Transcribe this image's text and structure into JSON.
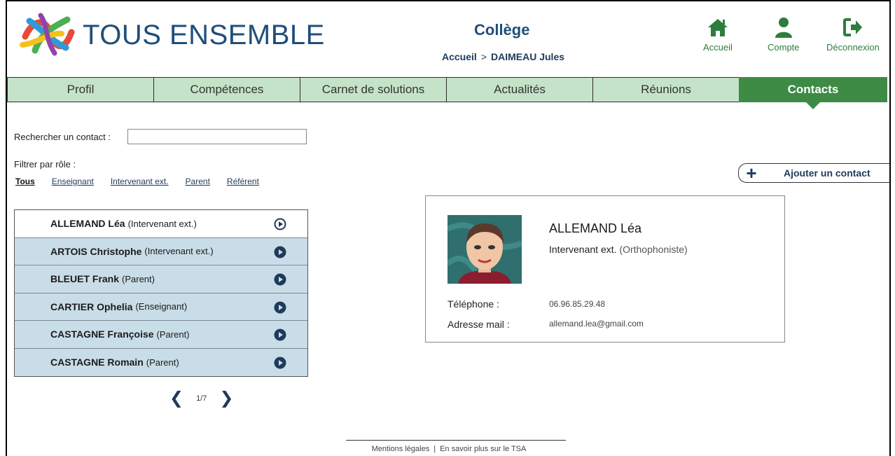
{
  "brand": "TOUS ENSEMBLE",
  "college": "Collège",
  "breadcrumb": {
    "home": "Accueil",
    "separator": ">",
    "current": "DAIMEAU Jules"
  },
  "top_nav": {
    "home": "Accueil",
    "account": "Compte",
    "logout": "Déconnexion"
  },
  "tabs": [
    "Profil",
    "Compétences",
    "Carnet de solutions",
    "Actualités",
    "Réunions",
    "Contacts"
  ],
  "active_tab": "Contacts",
  "search": {
    "label": "Rechercher un contact :",
    "value": ""
  },
  "filter": {
    "label": "Filtrer par rôle :",
    "options": [
      "Tous",
      "Enseignant",
      "Intervenant ext.",
      "Parent",
      "Référent"
    ],
    "active": "Tous"
  },
  "add_contact_label": "Ajouter un contact",
  "contacts": [
    {
      "name": "ALLEMAND Léa",
      "role": "(Intervenant ext.)",
      "selected": true
    },
    {
      "name": "ARTOIS Christophe",
      "role": "(Intervenant ext.)"
    },
    {
      "name": "BLEUET Frank",
      "role": "(Parent)"
    },
    {
      "name": "CARTIER Ophelia",
      "role": "(Enseignant)"
    },
    {
      "name": "CASTAGNE Françoise",
      "role": "(Parent)"
    },
    {
      "name": "CASTAGNE Romain",
      "role": "(Parent)"
    }
  ],
  "pagination": {
    "label": "1/7"
  },
  "detail": {
    "name": "ALLEMAND Léa",
    "role": "Intervenant ext.",
    "specialty": "(Orthophoniste)",
    "phone_label": "Téléphone :",
    "phone": "06.96.85.29.48",
    "email_label": "Adresse mail :",
    "email": "allemand.lea@gmail.com"
  },
  "footer": {
    "legal": "Mentions légales",
    "separator": "|",
    "about": "En savoir plus sur le TSA"
  },
  "colors": {
    "brand_blue": "#1f4e7a",
    "green": "#3d8b45",
    "tab_light": "#c5e3c8",
    "row_blue": "#c9dde8"
  }
}
